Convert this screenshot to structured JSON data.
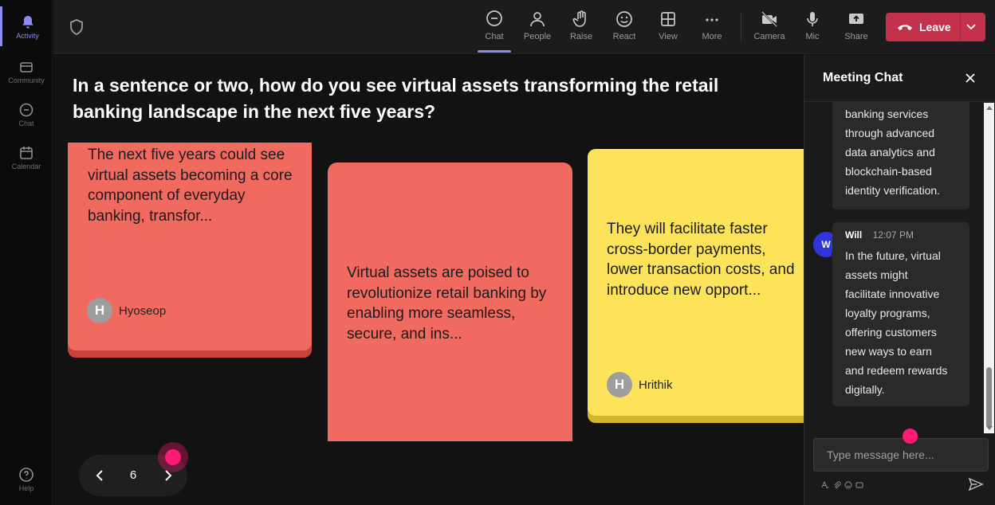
{
  "rail": {
    "items": [
      {
        "label": "Activity",
        "icon": "bell-icon",
        "active": true
      },
      {
        "label": "Community",
        "icon": "community-icon"
      },
      {
        "label": "Chat",
        "icon": "chat-icon"
      },
      {
        "label": "Calendar",
        "icon": "calendar-icon"
      }
    ],
    "help": {
      "label": "Help",
      "icon": "help-icon"
    }
  },
  "toolbar": {
    "buttons": [
      {
        "label": "Chat",
        "icon": "chat-bubble-icon",
        "active": true
      },
      {
        "label": "People",
        "icon": "people-icon"
      },
      {
        "label": "Raise",
        "icon": "raise-hand-icon"
      },
      {
        "label": "React",
        "icon": "smiley-icon"
      },
      {
        "label": "View",
        "icon": "grid-icon"
      },
      {
        "label": "More",
        "icon": "more-dots-icon"
      },
      {
        "label": "Camera",
        "icon": "camera-off-icon"
      },
      {
        "label": "Mic",
        "icon": "microphone-icon"
      },
      {
        "label": "Share",
        "icon": "share-icon"
      }
    ],
    "leave_label": "Leave",
    "accent": "#8b8cf0",
    "leave_color": "#c4314b"
  },
  "stage": {
    "question": "In a sentence or two, how do you see virtual assets transforming the retail banking landscape in the next five years?",
    "cards": [
      {
        "text": "The next five years could see virtual assets becoming a core component of everyday banking, transfor...",
        "author_initial": "H",
        "author": "Hyoseop",
        "color": "#f06a60"
      },
      {
        "text": "Virtual assets are poised to revolutionize retail banking by enabling more seamless, secure, and ins...",
        "color": "#f06a60"
      },
      {
        "text": "They will facilitate faster cross-border payments, lower transaction costs, and introduce new opport...",
        "author_initial": "H",
        "author": "Hrithik",
        "color": "#fde35a"
      }
    ],
    "pager": {
      "current": "6"
    }
  },
  "chat": {
    "title": "Meeting Chat",
    "messages": [
      {
        "lines": [
          "banking services",
          "through advanced",
          "data analytics and",
          "blockchain-based",
          "identity verification."
        ]
      },
      {
        "initial": "W",
        "sender": "Will",
        "time": "12:07 PM",
        "lines": [
          "In the future, virtual",
          "assets might",
          "facilitate innovative",
          "loyalty programs,",
          "offering customers",
          "new ways to earn",
          "and redeem rewards",
          "digitally."
        ]
      }
    ],
    "input_placeholder": "Type message here..."
  }
}
